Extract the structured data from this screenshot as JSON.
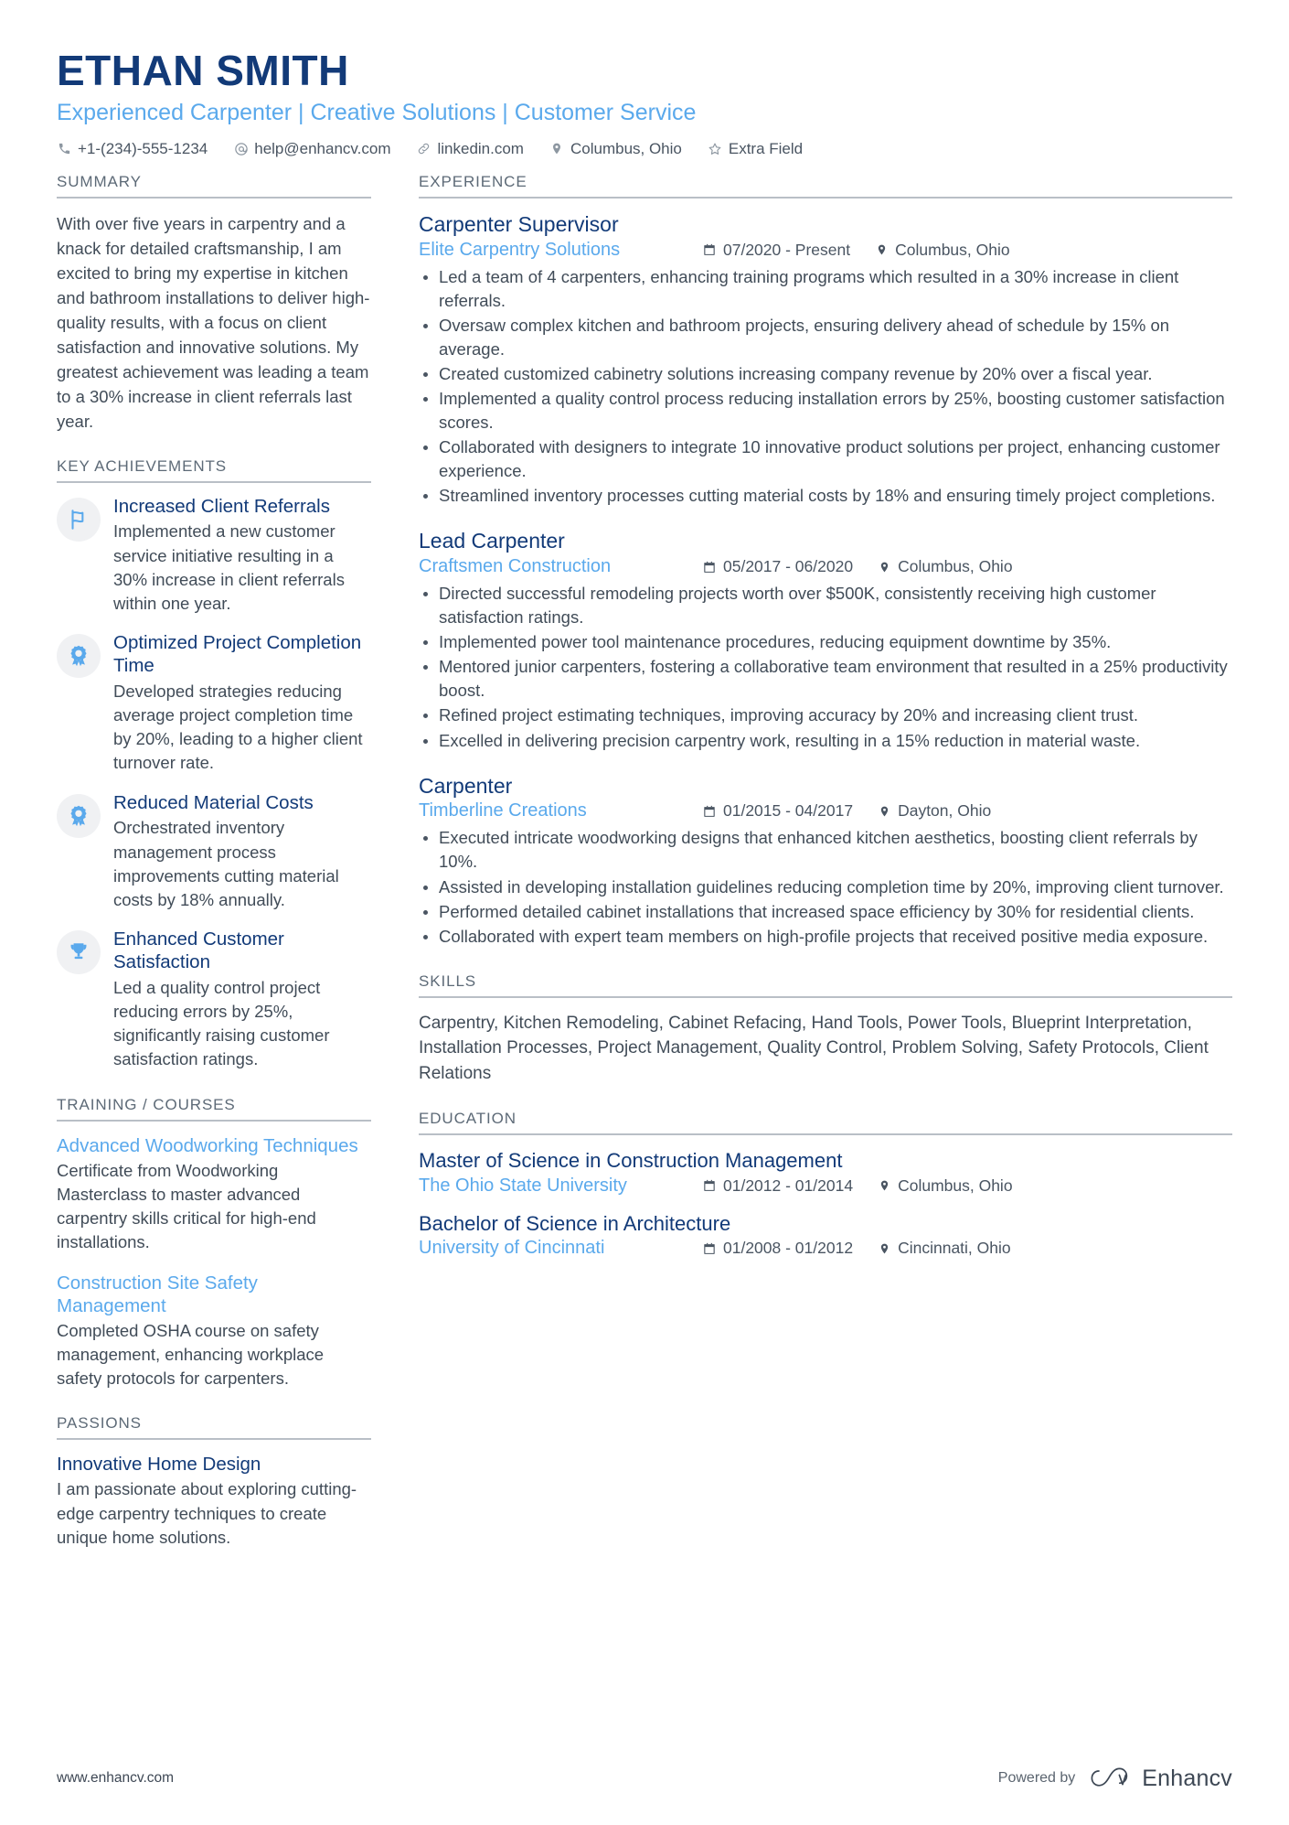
{
  "header": {
    "name": "ETHAN SMITH",
    "headline": "Experienced Carpenter | Creative Solutions | Customer Service",
    "contacts": [
      {
        "icon": "phone-icon",
        "text": "+1-(234)-555-1234"
      },
      {
        "icon": "email-icon",
        "text": "help@enhancv.com"
      },
      {
        "icon": "link-icon",
        "text": "linkedin.com"
      },
      {
        "icon": "location-pin-icon",
        "text": "Columbus, Ohio"
      },
      {
        "icon": "star-icon",
        "text": "Extra Field"
      }
    ]
  },
  "summary": {
    "title": "SUMMARY",
    "text": "With over five years in carpentry and a knack for detailed craftsmanship, I am excited to bring my expertise in kitchen and bathroom installations to deliver high-quality results, with a focus on client satisfaction and innovative solutions. My greatest achievement was leading a team to a 30% increase in client referrals last year."
  },
  "key_achievements": {
    "title": "KEY ACHIEVEMENTS",
    "items": [
      {
        "icon": "flag-icon",
        "title": "Increased Client Referrals",
        "desc": "Implemented a new customer service initiative resulting in a 30% increase in client referrals within one year."
      },
      {
        "icon": "award-ribbon-icon",
        "title": "Optimized Project Completion Time",
        "desc": "Developed strategies reducing average project completion time by 20%, leading to a higher client turnover rate."
      },
      {
        "icon": "award-ribbon-icon",
        "title": "Reduced Material Costs",
        "desc": "Orchestrated inventory management process improvements cutting material costs by 18% annually."
      },
      {
        "icon": "trophy-icon",
        "title": "Enhanced Customer Satisfaction",
        "desc": "Led a quality control project reducing errors by 25%, significantly raising customer satisfaction ratings."
      }
    ]
  },
  "training": {
    "title": "TRAINING / COURSES",
    "items": [
      {
        "title": "Advanced Woodworking Techniques",
        "desc": "Certificate from Woodworking Masterclass to master advanced carpentry skills critical for high-end installations."
      },
      {
        "title": "Construction Site Safety Management",
        "desc": "Completed OSHA course on safety management, enhancing workplace safety protocols for carpenters."
      }
    ]
  },
  "passions": {
    "title": "PASSIONS",
    "items": [
      {
        "title": "Innovative Home Design",
        "desc": "I am passionate about exploring cutting-edge carpentry techniques to create unique home solutions."
      }
    ]
  },
  "experience": {
    "title": "EXPERIENCE",
    "jobs": [
      {
        "role": "Carpenter Supervisor",
        "company": "Elite Carpentry Solutions",
        "dates": "07/2020 - Present",
        "location": "Columbus, Ohio",
        "bullets": [
          "Led a team of 4 carpenters, enhancing training programs which resulted in a 30% increase in client referrals.",
          "Oversaw complex kitchen and bathroom projects, ensuring delivery ahead of schedule by 15% on average.",
          "Created customized cabinetry solutions increasing company revenue by 20% over a fiscal year.",
          "Implemented a quality control process reducing installation errors by 25%, boosting customer satisfaction scores.",
          "Collaborated with designers to integrate 10 innovative product solutions per project, enhancing customer experience.",
          "Streamlined inventory processes cutting material costs by 18% and ensuring timely project completions."
        ]
      },
      {
        "role": "Lead Carpenter",
        "company": "Craftsmen Construction",
        "dates": "05/2017 - 06/2020",
        "location": "Columbus, Ohio",
        "bullets": [
          "Directed successful remodeling projects worth over $500K, consistently receiving high customer satisfaction ratings.",
          "Implemented power tool maintenance procedures, reducing equipment downtime by 35%.",
          "Mentored junior carpenters, fostering a collaborative team environment that resulted in a 25% productivity boost.",
          "Refined project estimating techniques, improving accuracy by 20% and increasing client trust.",
          "Excelled in delivering precision carpentry work, resulting in a 15% reduction in material waste."
        ]
      },
      {
        "role": "Carpenter",
        "company": "Timberline Creations",
        "dates": "01/2015 - 04/2017",
        "location": "Dayton, Ohio",
        "bullets": [
          "Executed intricate woodworking designs that enhanced kitchen aesthetics, boosting client referrals by 10%.",
          "Assisted in developing installation guidelines reducing completion time by 20%, improving client turnover.",
          "Performed detailed cabinet installations that increased space efficiency by 30% for residential clients.",
          "Collaborated with expert team members on high-profile projects that received positive media exposure."
        ]
      }
    ]
  },
  "skills": {
    "title": "SKILLS",
    "text": "Carpentry, Kitchen Remodeling, Cabinet Refacing, Hand Tools, Power Tools, Blueprint Interpretation, Installation Processes, Project Management, Quality Control, Problem Solving, Safety Protocols, Client Relations"
  },
  "education": {
    "title": "EDUCATION",
    "items": [
      {
        "degree": "Master of Science in Construction Management",
        "school": "The Ohio State University",
        "dates": "01/2012 - 01/2014",
        "location": "Columbus, Ohio"
      },
      {
        "degree": "Bachelor of Science in Architecture",
        "school": "University of Cincinnati",
        "dates": "01/2008 - 01/2012",
        "location": "Cincinnati, Ohio"
      }
    ]
  },
  "footer": {
    "url": "www.enhancv.com",
    "powered_by": "Powered by",
    "brand": "Enhancv"
  },
  "colors": {
    "navy": "#123a78",
    "light_blue": "#5aa9ec",
    "body_text": "#414c58",
    "muted": "#5d6a77",
    "rule": "#b9bfc6",
    "badge_bg": "#f0f1f3"
  }
}
